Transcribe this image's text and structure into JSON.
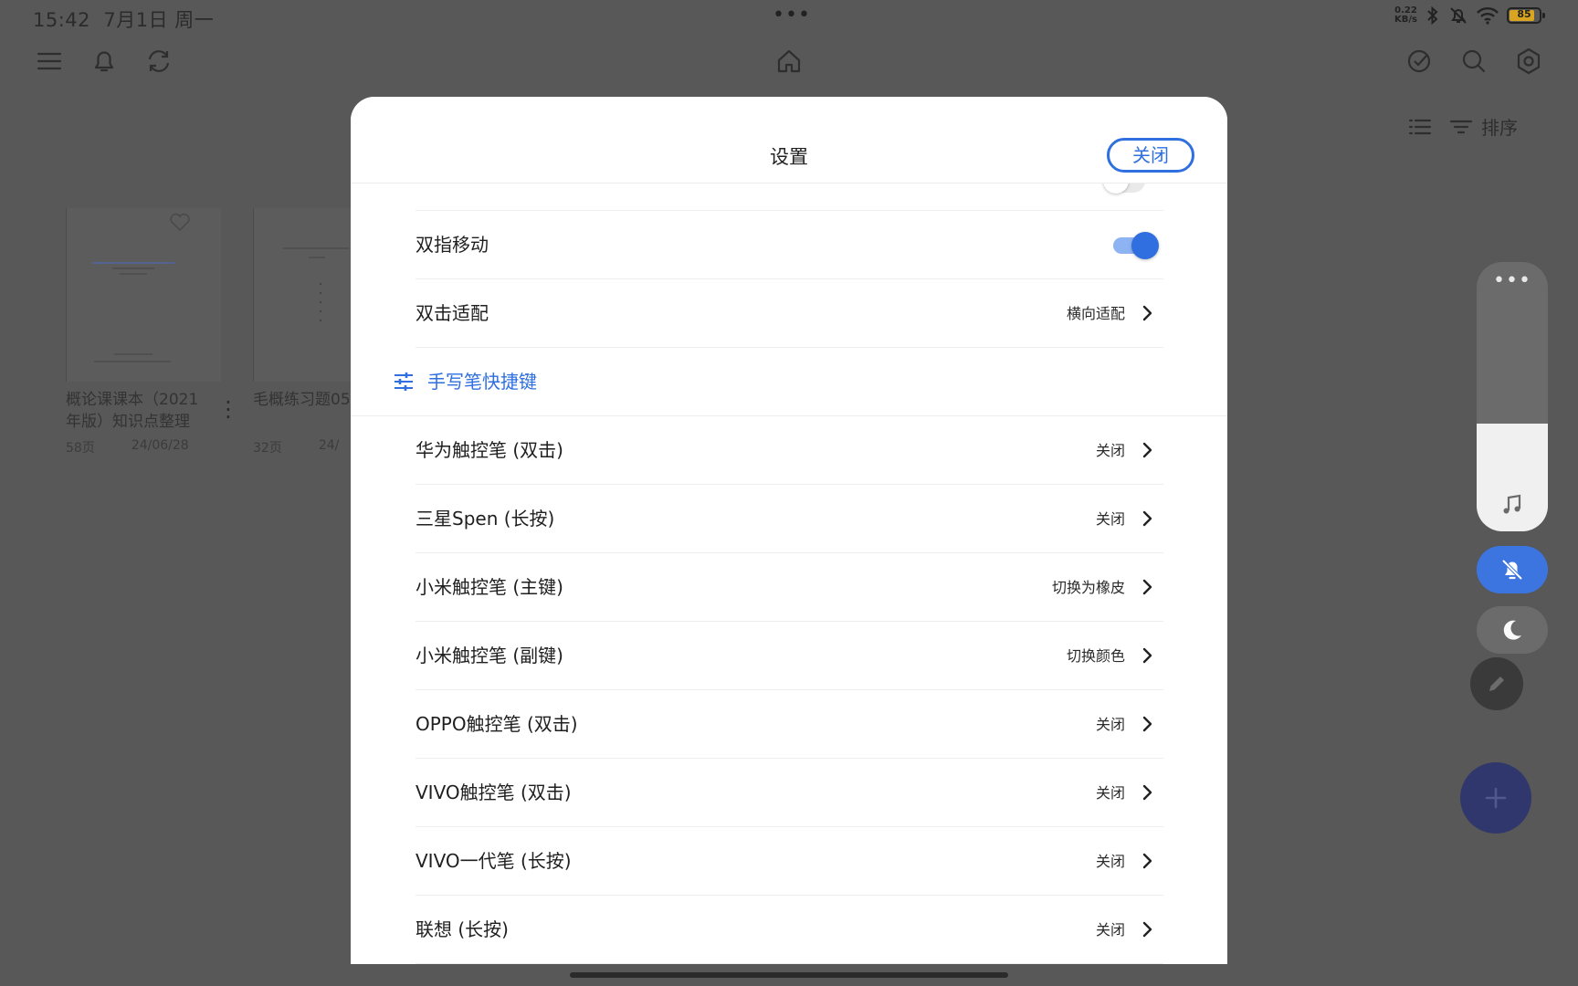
{
  "status_bar": {
    "time": "15:42",
    "date": "7月1日 周一",
    "center_dots": "•••",
    "net_speed_value": "0.22",
    "net_speed_unit": "KB/s",
    "battery": "85",
    "battery_level": 0.85,
    "battery_color": "#d9a521"
  },
  "toolbar": {
    "left_icons": [
      "menu-icon",
      "bell-icon",
      "sync-icon"
    ],
    "center_icon": "home-icon",
    "right_icons": [
      "check-circle-icon",
      "search-icon",
      "gear-icon"
    ],
    "sort_label": "排序"
  },
  "documents": [
    {
      "title": "概论课课本（2021年版）知识点整理",
      "pages": "58页",
      "date": "24/06/28"
    },
    {
      "title": "毛概练习题05",
      "pages": "32页",
      "date": "24/"
    }
  ],
  "side_controls": {
    "more_dots": "•••",
    "volume_level": 0.4,
    "accent": "#3d75e0"
  },
  "dialog": {
    "title": "设置",
    "close_label": "关闭",
    "accent": "#2f6fe0",
    "rows": [
      {
        "label": "双指移动",
        "type": "toggle",
        "on": true
      },
      {
        "label": "双击适配",
        "type": "value",
        "value": "横向适配"
      }
    ],
    "section": {
      "label": "手写笔快捷键",
      "icon": "sliders-icon"
    },
    "pen_rows": [
      {
        "label": "华为触控笔 (双击)",
        "value": "关闭"
      },
      {
        "label": "三星Spen (长按)",
        "value": "关闭"
      },
      {
        "label": "小米触控笔 (主键)",
        "value": "切换为橡皮"
      },
      {
        "label": "小米触控笔 (副键)",
        "value": "切换颜色"
      },
      {
        "label": "OPPO触控笔 (双击)",
        "value": "关闭"
      },
      {
        "label": "VIVO触控笔 (双击)",
        "value": "关闭"
      },
      {
        "label": "VIVO一代笔 (长按)",
        "value": "关闭"
      },
      {
        "label": "联想 (长按)",
        "value": "关闭"
      }
    ]
  }
}
